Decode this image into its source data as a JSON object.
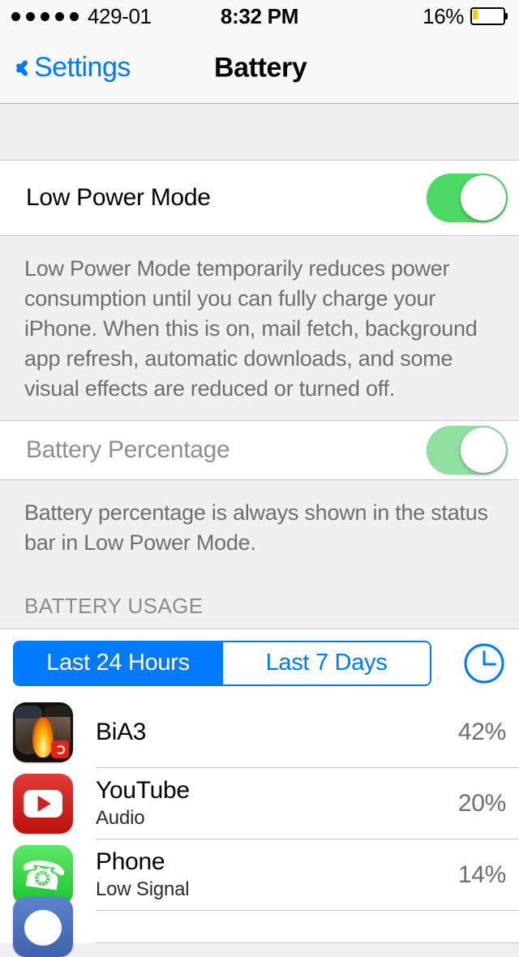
{
  "status_bar": {
    "signal_dots": 5,
    "carrier": "429-01",
    "time": "8:32 PM",
    "battery_percent": "16%",
    "battery_level": 16,
    "battery_color": "#FFCC00"
  },
  "nav": {
    "back_label": "Settings",
    "title": "Battery"
  },
  "low_power": {
    "label": "Low Power Mode",
    "enabled": true,
    "note": "Low Power Mode temporarily reduces power consumption until you can fully charge your iPhone. When this is on, mail fetch, background app refresh, automatic downloads, and some visual effects are reduced or turned off."
  },
  "battery_percentage": {
    "label": "Battery Percentage",
    "enabled": true,
    "disabled_control": true,
    "note": "Battery percentage is always shown in the status bar in Low Power Mode."
  },
  "usage": {
    "header": "BATTERY USAGE",
    "segments": [
      {
        "label": "Last 24 Hours",
        "selected": true
      },
      {
        "label": "Last 7 Days",
        "selected": false
      }
    ],
    "time_toggle_icon": "clock-icon",
    "apps": [
      {
        "name": "BiA3",
        "subtitle": "",
        "percent": "42%",
        "icon": "bia3-app-icon"
      },
      {
        "name": "YouTube",
        "subtitle": "Audio",
        "percent": "20%",
        "icon": "youtube-app-icon"
      },
      {
        "name": "Phone",
        "subtitle": "Low Signal",
        "percent": "14%",
        "icon": "phone-app-icon"
      },
      {
        "name": "",
        "subtitle": "",
        "percent": "",
        "icon": "messenger-app-icon"
      }
    ]
  },
  "colors": {
    "tint": "#007AFF",
    "switch_on": "#4CD964",
    "switch_disabled": "#8FE0A0",
    "group_bg": "#EFEFF4",
    "separator": "#C8C7CC"
  }
}
